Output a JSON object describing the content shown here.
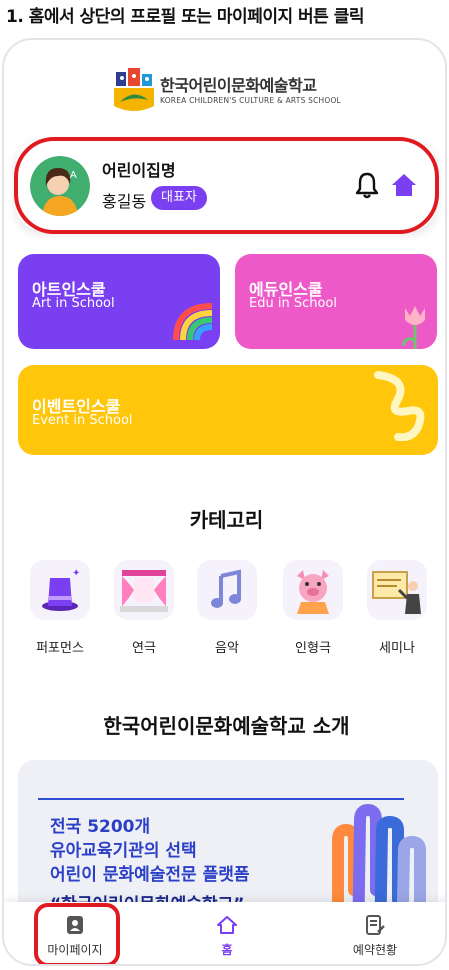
{
  "instruction": "1. 홈에서 상단의 프로필 또는 마이페이지 버튼 클릭",
  "logo": {
    "name": "한국어린이문화예술학교",
    "subtitle": "KOREA CHILDREN'S CULTURE & ARTS SCHOOL"
  },
  "profile": {
    "school_name": "어린이집명",
    "user_name": "홍길동",
    "role_badge": "대표자",
    "notification_icon": "bell-icon",
    "home_icon": "home-icon"
  },
  "tiles": [
    {
      "title": "아트인스쿨",
      "subtitle": "Art in School",
      "color": "#7a3ff0"
    },
    {
      "title": "에듀인스쿨",
      "subtitle": "Edu in School",
      "color": "#ee59c8"
    },
    {
      "title": "이벤트인스쿨",
      "subtitle": "Event in School",
      "color": "#ffc60b"
    }
  ],
  "categories": {
    "title": "카테고리",
    "items": [
      {
        "label": "퍼포먼스",
        "icon": "magic-hat-icon"
      },
      {
        "label": "연극",
        "icon": "stage-icon"
      },
      {
        "label": "음악",
        "icon": "music-note-icon"
      },
      {
        "label": "인형극",
        "icon": "pig-puppet-icon"
      },
      {
        "label": "세미나",
        "icon": "presenter-icon"
      }
    ]
  },
  "intro": {
    "title": "한국어린이문화예술학교 소개",
    "banner_lines": [
      "전국 5200개",
      "유아교육기관의 선택",
      "어린이 문화예술전문 플랫폼"
    ],
    "banner_quote": "“한국어린이문화예술학교”"
  },
  "bottom_nav": [
    {
      "label": "마이페이지",
      "icon": "id-badge-icon",
      "active": false
    },
    {
      "label": "홈",
      "icon": "home-icon",
      "active": true
    },
    {
      "label": "예약현황",
      "icon": "document-edit-icon",
      "active": false
    }
  ],
  "colors": {
    "accent": "#7a3ff0",
    "highlight": "#e11a22"
  }
}
